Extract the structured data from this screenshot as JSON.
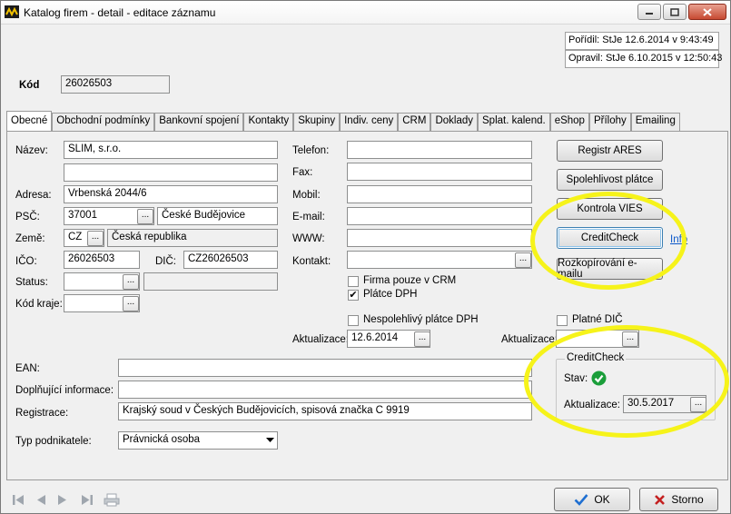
{
  "window": {
    "title": "Katalog firem - detail - editace záznamu"
  },
  "meta": {
    "created": "Pořídil: StJe 12.6.2014 v 9:43:49",
    "modified": "Opravil: StJe 6.10.2015 v 12:50:43"
  },
  "code": {
    "label": "Kód",
    "value": "26026503"
  },
  "tabs": [
    "Obecné",
    "Obchodní podmínky",
    "Bankovní spojení",
    "Kontakty",
    "Skupiny",
    "Indiv. ceny",
    "CRM",
    "Doklady",
    "Splat. kalend.",
    "eShop",
    "Přílohy",
    "Emailing"
  ],
  "left": {
    "name_label": "Název:",
    "name_value": "SLIM, s.r.o.",
    "name2_value": "",
    "address_label": "Adresa:",
    "address_value": "Vrbenská 2044/6",
    "psc_label": "PSČ:",
    "psc_value": "37001",
    "city_value": "České Budějovice",
    "country_label": "Země:",
    "country_code": "CZ",
    "country_name": "Česká republika",
    "ico_label": "IČO:",
    "ico_value": "26026503",
    "dic_label": "DIČ:",
    "dic_value": "CZ26026503",
    "status_label": "Status:",
    "status_value": "",
    "status_desc": "",
    "region_label": "Kód kraje:",
    "region_value": ""
  },
  "middle": {
    "phone_label": "Telefon:",
    "phone_value": "",
    "fax_label": "Fax:",
    "fax_value": "",
    "mobile_label": "Mobil:",
    "mobile_value": "",
    "email_label": "E-mail:",
    "email_value": "",
    "www_label": "WWW:",
    "www_value": "",
    "contact_label": "Kontakt:",
    "contact_value": "",
    "crm_only_label": "Firma pouze v CRM",
    "crm_only_checked": false,
    "vat_payer_label": "Plátce DPH",
    "vat_payer_checked": true,
    "unreliable_label": "Nespolehlivý plátce DPH",
    "unreliable_checked": false,
    "update_label": "Aktualizace:",
    "update_value": "12.6.2014"
  },
  "right": {
    "ares_button": "Registr ARES",
    "reliability_button": "Spolehlivost plátce",
    "vies_button": "Kontrola VIES",
    "creditcheck_button": "CreditCheck",
    "info_link": "Info",
    "copy_email_button": "Rozkopírování e-mailu",
    "valid_dic_label": "Platné DIČ",
    "valid_dic_checked": false,
    "update_label": "Aktualizace:",
    "update_value": ""
  },
  "creditcheck": {
    "legend": "CreditCheck",
    "state_label": "Stav:",
    "update_label": "Aktualizace:",
    "update_value": "30.5.2017"
  },
  "lower": {
    "ean_label": "EAN:",
    "ean_value": "",
    "extra_label": "Doplňující informace:",
    "extra_value": "",
    "registration_label": "Registrace:",
    "registration_value": "Krajský soud v Českých Budějovicích, spisová značka C 9919",
    "business_type_label": "Typ podnikatele:",
    "business_type_value": "Právnická osoba"
  },
  "footer": {
    "ok_label": "OK",
    "cancel_label": "Storno"
  },
  "colors": {
    "highlight": "#f6f31a",
    "ok_check": "#1f6fd1",
    "cancel_x": "#c42020",
    "status_ok": "#1a9e3a"
  }
}
